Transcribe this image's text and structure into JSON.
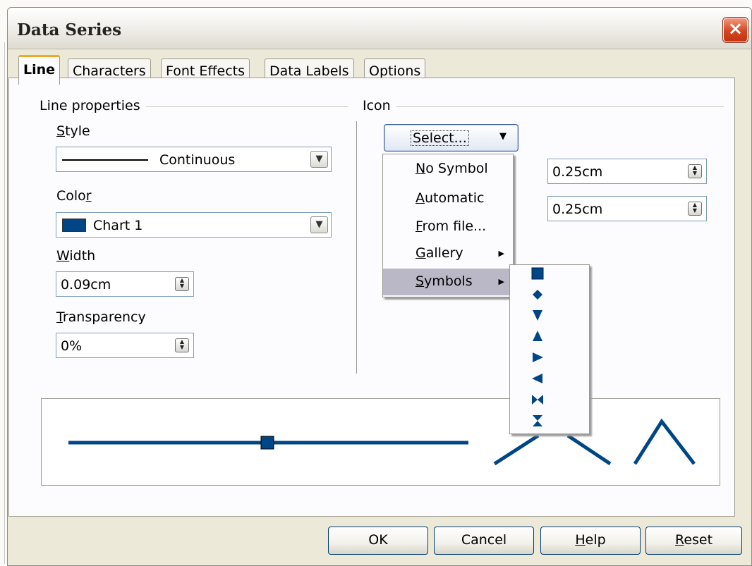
{
  "window": {
    "title": "Data Series",
    "close_icon": "×"
  },
  "tabs": [
    {
      "label": "Line",
      "active": true
    },
    {
      "label": "Characters",
      "active": false
    },
    {
      "label": "Font Effects",
      "active": false
    },
    {
      "label": "Data Labels",
      "active": false
    },
    {
      "label": "Options",
      "active": false
    }
  ],
  "line_properties": {
    "group_label": "Line properties",
    "style": {
      "label_pre": "",
      "label_u": "S",
      "label_post": "tyle",
      "value": "Continuous"
    },
    "color": {
      "label_pre": "Colo",
      "label_u": "r",
      "label_post": "",
      "value": "Chart 1",
      "swatch": "#004586"
    },
    "width": {
      "label_pre": "",
      "label_u": "W",
      "label_post": "idth",
      "value": "0.09cm"
    },
    "transparency": {
      "label_pre": "",
      "label_u": "T",
      "label_post": "ransparency",
      "value": "0%"
    }
  },
  "icon": {
    "group_label": "Icon",
    "select_button": "Select...",
    "width_value": "0.25cm",
    "height_value": "0.25cm"
  },
  "menu": {
    "items": [
      {
        "pre": "",
        "u": "N",
        "post": "o Symbol",
        "submenu": false
      },
      {
        "pre": "",
        "u": "A",
        "post": "utomatic",
        "submenu": false
      },
      {
        "pre": "",
        "u": "F",
        "post": "rom file...",
        "submenu": false
      },
      {
        "pre": "",
        "u": "G",
        "post": "allery",
        "submenu": true
      },
      {
        "pre": "",
        "u": "S",
        "post": "ymbols",
        "submenu": true,
        "highlighted": true
      }
    ],
    "symbols": [
      "square",
      "diamond",
      "triangle-down",
      "triangle-up",
      "triangle-right",
      "triangle-left",
      "bowtie",
      "hourglass"
    ]
  },
  "preview": {
    "line_color": "#004586"
  },
  "buttons": {
    "ok": {
      "pre": "OK",
      "u": "",
      "post": ""
    },
    "cancel": {
      "pre": "Cancel",
      "u": "",
      "post": ""
    },
    "help": {
      "pre": "",
      "u": "H",
      "post": "elp"
    },
    "reset": {
      "pre": "",
      "u": "R",
      "post": "eset"
    }
  },
  "colors": {
    "accent_tab": "#f3a628",
    "chart_line": "#004586",
    "menu_highlight": "#bab7c6"
  }
}
